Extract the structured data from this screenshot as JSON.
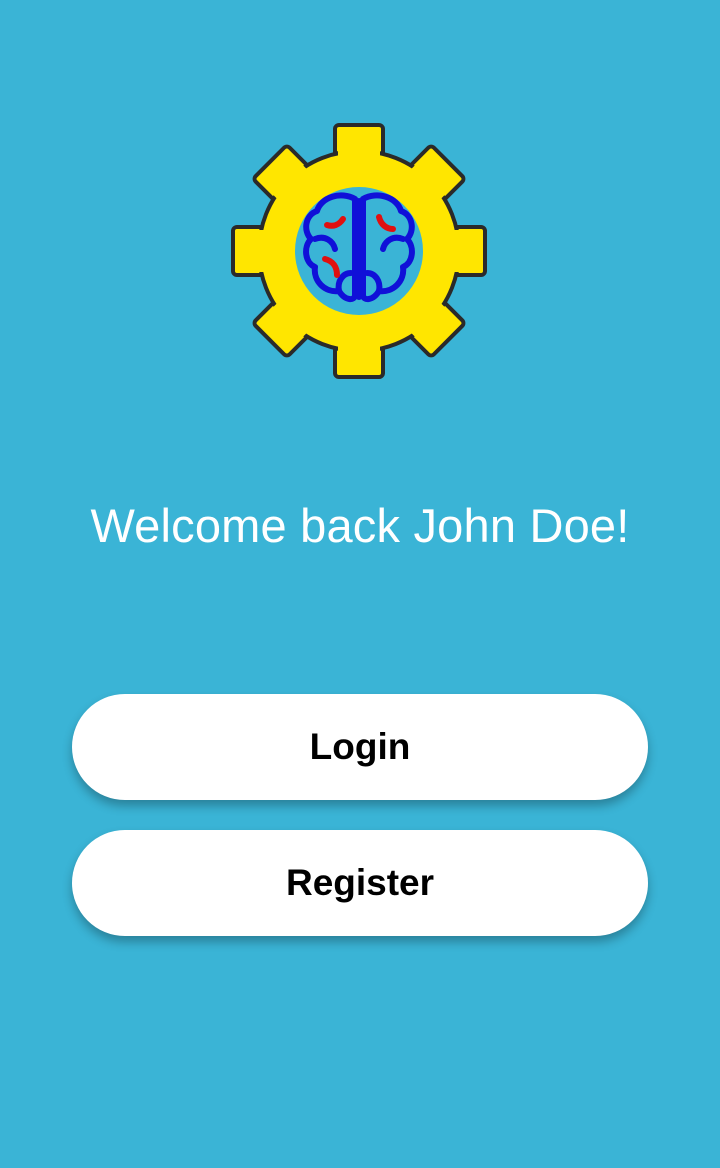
{
  "app": {
    "logo_icon": "gear-brain-icon",
    "welcome_text": "Welcome back John Doe!"
  },
  "actions": {
    "login_label": "Login",
    "register_label": "Register"
  },
  "colors": {
    "background": "#3ab4d6",
    "gear": "#ffe600",
    "brain": "#1010d8",
    "accent": "#e01010",
    "button": "#ffffff"
  }
}
